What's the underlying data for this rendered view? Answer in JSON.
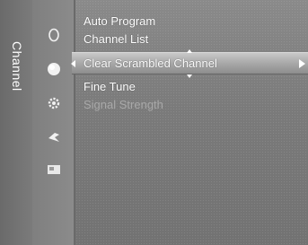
{
  "sidebar": {
    "label": "Channel"
  },
  "icons": [
    {
      "name": "picture-icon"
    },
    {
      "name": "sound-icon"
    },
    {
      "name": "settings-icon"
    },
    {
      "name": "input-icon"
    },
    {
      "name": "application-icon"
    }
  ],
  "menu": {
    "items": [
      {
        "label": "Auto Program"
      },
      {
        "label": "Channel List"
      },
      {
        "label": "Clear Scrambled Channel"
      },
      {
        "label": "Fine Tune"
      },
      {
        "label": "Signal Strength"
      }
    ]
  },
  "colors": {
    "selected_bar": "#b0b0b0",
    "background": "#7e7e7e",
    "disabled_text": "#a9a9a9"
  }
}
